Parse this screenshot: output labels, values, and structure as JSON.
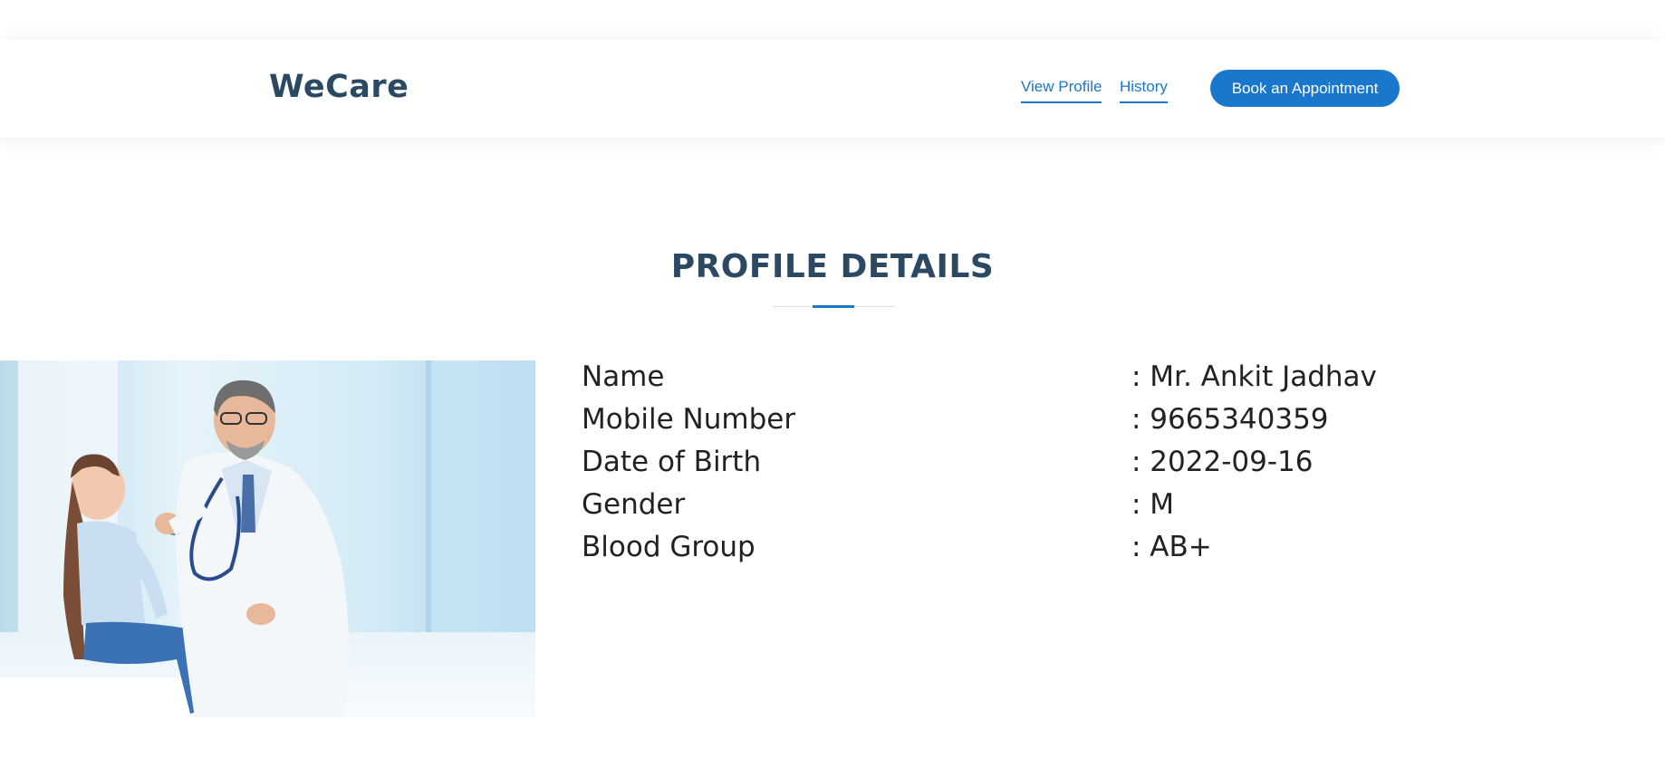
{
  "header": {
    "logo": "WeCare",
    "nav": [
      {
        "label": "View Profile"
      },
      {
        "label": "History"
      }
    ],
    "cta_label": "Book an Appointment"
  },
  "colors": {
    "accent": "#1977cc",
    "heading": "#2c4964",
    "text": "#222222"
  },
  "section": {
    "title": "PROFILE DETAILS"
  },
  "image": {
    "description_icon": "doctor-with-child-photo"
  },
  "profile": {
    "fields": [
      {
        "label": "Name",
        "value": ": Mr. Ankit Jadhav"
      },
      {
        "label": "Mobile Number",
        "value": ": 9665340359"
      },
      {
        "label": "Date of Birth",
        "value": ": 2022-09-16"
      },
      {
        "label": "Gender",
        "value": ": M"
      },
      {
        "label": "Blood Group",
        "value": ": AB+"
      }
    ]
  }
}
